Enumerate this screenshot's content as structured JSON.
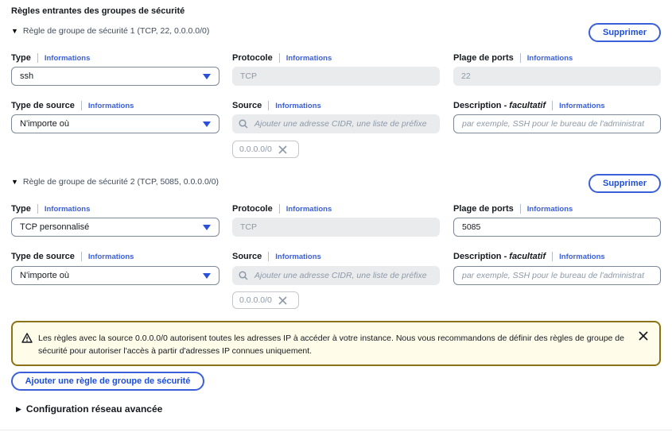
{
  "section": {
    "heading": "Règles entrantes des groupes de sécurité"
  },
  "common": {
    "info": "Informations",
    "delete_label": "Supprimer",
    "labels": {
      "type": "Type",
      "protocol": "Protocole",
      "port_range": "Plage de ports",
      "source_type": "Type de source",
      "source": "Source",
      "description_prefix": "Description - ",
      "description_optional": "facultatif"
    },
    "source_placeholder": "Ajouter une adresse CIDR, une liste de préfixe",
    "description_placeholder": "par exemple, SSH pour le bureau de l'administrat",
    "token_remove_icon": "close-icon",
    "search_icon": "search-icon"
  },
  "rules": [
    {
      "title": "Règle de groupe de sécurité 1 (TCP, 22, 0.0.0.0/0)",
      "type": "ssh",
      "protocol": "TCP",
      "port_range": "22",
      "source_type": "N'importe où",
      "source_token": "0.0.0.0/0"
    },
    {
      "title": "Règle de groupe de sécurité 2 (TCP, 5085, 0.0.0.0/0)",
      "type": "TCP personnalisé",
      "protocol": "TCP",
      "port_range": "5085",
      "source_type": "N'importe où",
      "source_token": "0.0.0.0/0"
    }
  ],
  "alert": {
    "icon": "warning-icon",
    "text": "Les règles avec la source 0.0.0.0/0 autorisent toutes les adresses IP à accéder à votre instance. Nous vous recommandons de définir des règles de groupe de sécurité pour autoriser l'accès à partir d'adresses IP connues uniquement.",
    "close_icon": "close-icon"
  },
  "add_rule_label": "Ajouter une règle de groupe de sécurité",
  "advanced_config_label": "Configuration réseau avancée",
  "colors": {
    "accent": "#3b5fd9",
    "warning_border": "#8c7216",
    "warning_bg": "#fffce9"
  }
}
